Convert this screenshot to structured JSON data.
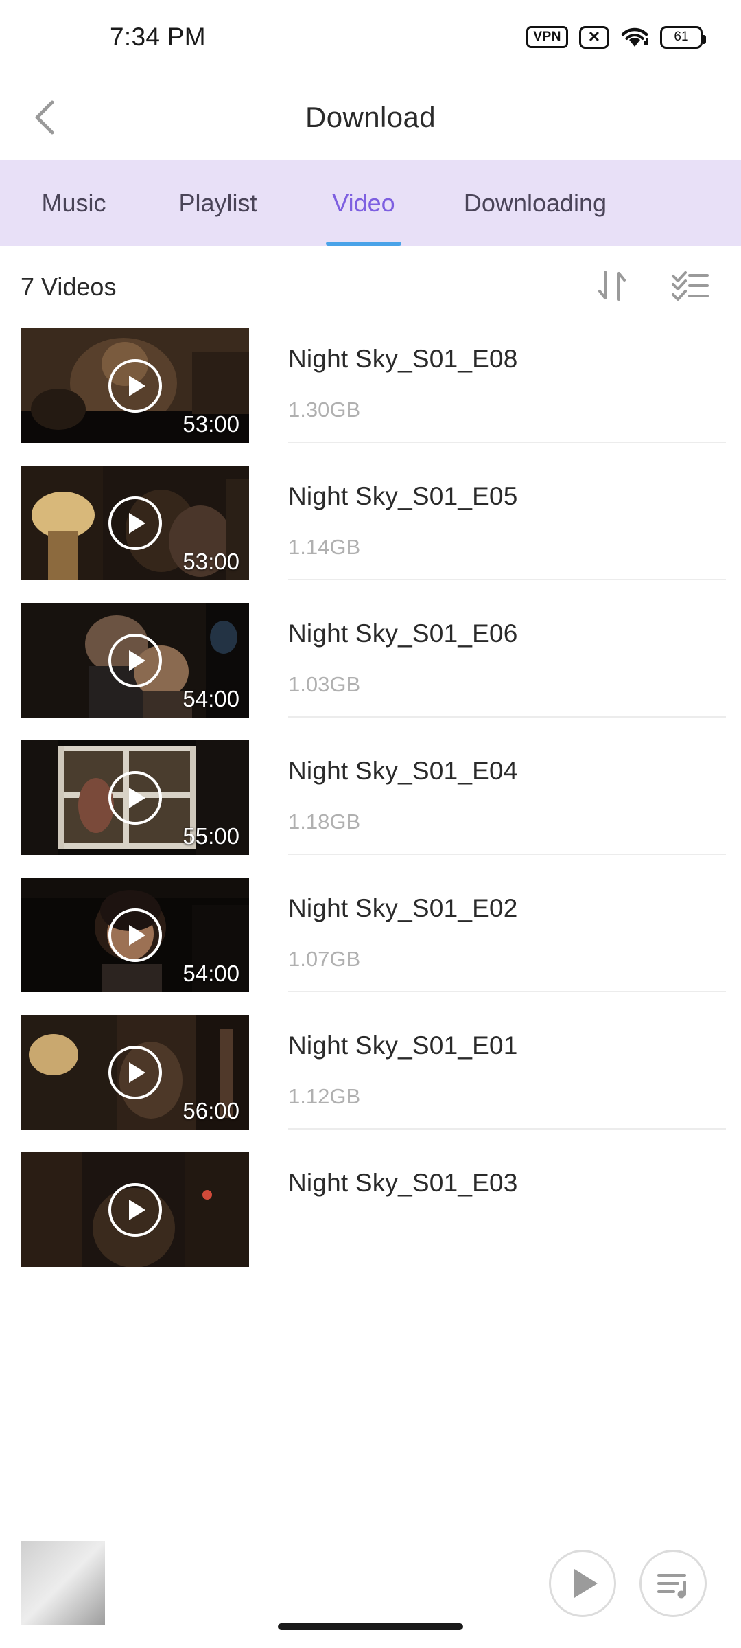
{
  "statusbar": {
    "time": "7:34 PM",
    "vpn_label": "VPN",
    "x_label": "✕",
    "battery_level": "61"
  },
  "appbar": {
    "title": "Download",
    "back_icon": "chevron-left-icon"
  },
  "tabs": [
    {
      "label": "Music",
      "active": false
    },
    {
      "label": "Playlist",
      "active": false
    },
    {
      "label": "Video",
      "active": true
    },
    {
      "label": "Downloading",
      "active": false
    }
  ],
  "list_header": {
    "count_label": "7 Videos",
    "sort_icon": "sort-arrows-icon",
    "select_icon": "multi-select-icon"
  },
  "videos": [
    {
      "title": "Night Sky_S01_E08",
      "size": "1.30GB",
      "duration": "53:00"
    },
    {
      "title": "Night Sky_S01_E05",
      "size": "1.14GB",
      "duration": "53:00"
    },
    {
      "title": "Night Sky_S01_E06",
      "size": "1.03GB",
      "duration": "54:00"
    },
    {
      "title": "Night Sky_S01_E04",
      "size": "1.18GB",
      "duration": "55:00"
    },
    {
      "title": "Night Sky_S01_E02",
      "size": "1.07GB",
      "duration": "54:00"
    },
    {
      "title": "Night Sky_S01_E01",
      "size": "1.12GB",
      "duration": "56:00"
    },
    {
      "title": "Night Sky_S01_E03",
      "size": "",
      "duration": ""
    }
  ],
  "player_bar": {
    "play_icon": "play-icon",
    "queue_icon": "playlist-queue-icon"
  },
  "colors": {
    "tab_bar_bg": "#e8e0f7",
    "active_tab": "#7d5fe0",
    "active_underline": "#4aa3e8",
    "title_text": "#2a2a2a",
    "muted_text": "#b0b0b0"
  }
}
